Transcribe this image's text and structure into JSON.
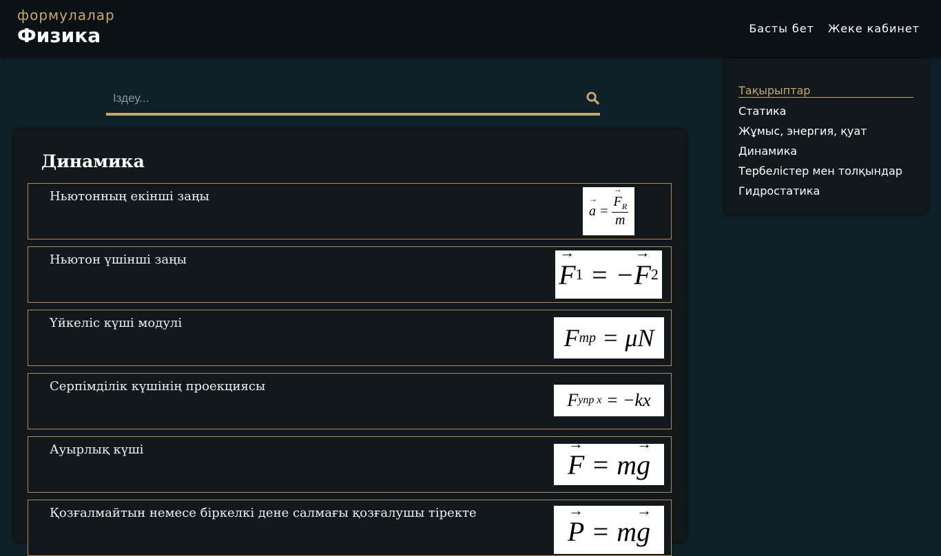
{
  "header": {
    "brand_subtitle": "формулалар",
    "brand_title": "Физика",
    "nav": [
      "Басты бет",
      "Жеке кабинет"
    ]
  },
  "search": {
    "placeholder": "Іздеу..."
  },
  "colors": {
    "accent": "#c9a66b",
    "background": "#0f2128",
    "panel": "#11191d"
  },
  "main": {
    "section_title": "Динамика",
    "cards": [
      {
        "label": "Ньютонның екінші заңы",
        "formula": "a = F_R / m"
      },
      {
        "label": "Ньютон үшінші заңы",
        "formula": "F_1 = −F_2"
      },
      {
        "label": "Үйкеліс күші модулі",
        "formula": "F_mp = μN"
      },
      {
        "label": "Серпімділік күшінің проекциясы",
        "formula": "F_упр x = −kx"
      },
      {
        "label": "Ауырлық күші",
        "formula": "F = mg"
      },
      {
        "label": "Қозғалмайтын немесе біркелкі дене салмағы қозғалушы тіректе",
        "formula": "P = mg"
      }
    ]
  },
  "sidebar": {
    "title": "Тақырыптар",
    "items": [
      "Статика",
      "Жұмыс, энергия, қуат",
      "Динамика",
      "Тербелістер мен толқындар",
      "Гидростатика"
    ]
  }
}
